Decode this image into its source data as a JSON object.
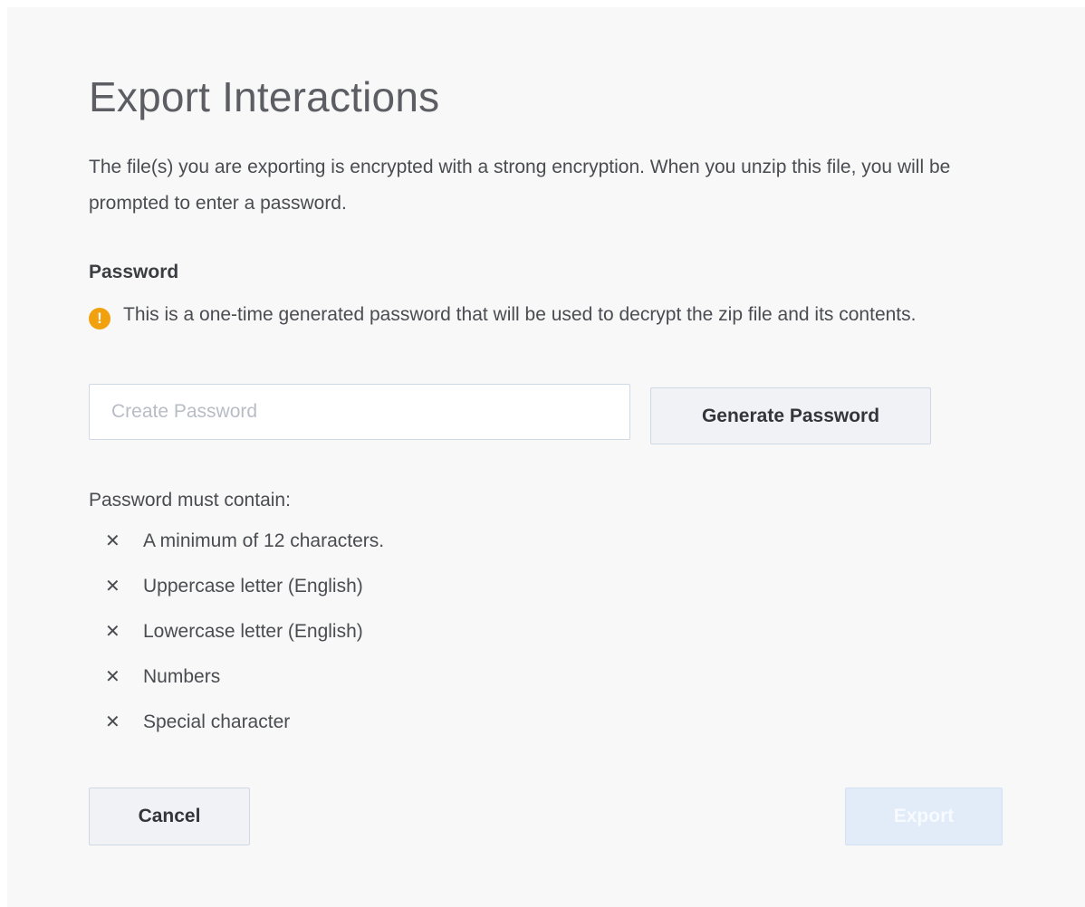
{
  "dialog": {
    "title": "Export Interactions",
    "description": "The file(s) you are exporting is encrypted with a strong encryption. When you unzip this file, you will be prompted to enter a password."
  },
  "password": {
    "label": "Password",
    "note_icon": "warning-icon",
    "note_icon_glyph": "!",
    "note": "This is a one-time generated password that will be used to decrypt the zip file and its contents.",
    "input_value": "",
    "input_placeholder": "Create Password",
    "generate_label": "Generate Password"
  },
  "requirements": {
    "heading": "Password must contain:",
    "status_icon": "close-icon",
    "status_glyph": "✕",
    "items": [
      {
        "label": "A minimum of 12 characters.",
        "met": false
      },
      {
        "label": "Uppercase letter (English)",
        "met": false
      },
      {
        "label": "Lowercase letter (English)",
        "met": false
      },
      {
        "label": "Numbers",
        "met": false
      },
      {
        "label": "Special character",
        "met": false
      }
    ]
  },
  "actions": {
    "cancel_label": "Cancel",
    "export_label": "Export",
    "export_enabled": false
  },
  "colors": {
    "background": "#f8f8f8",
    "warning": "#f1a10e",
    "export_disabled_bg": "#e2ecf8"
  }
}
